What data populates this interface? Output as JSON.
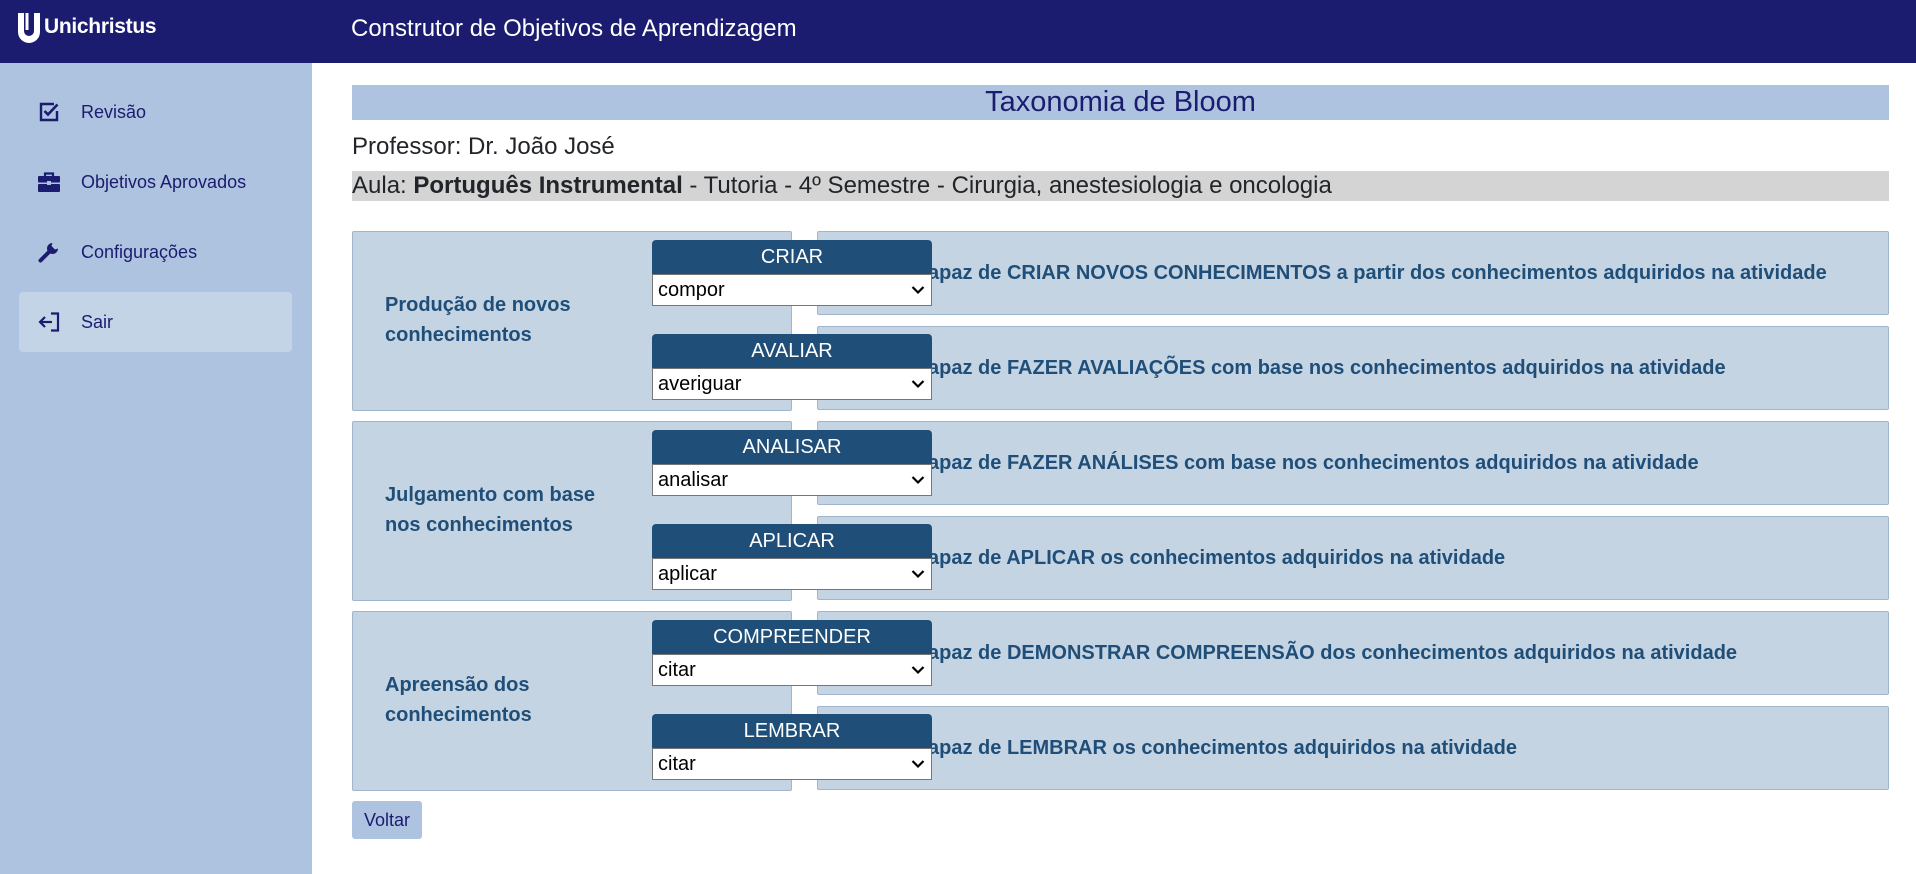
{
  "header": {
    "brand": "Unichristus",
    "title": "Construtor de Objetivos de Aprendizagem"
  },
  "sidebar": {
    "items": [
      {
        "label": "Revisão",
        "icon": "checkbox-edit-icon"
      },
      {
        "label": "Objetivos Aprovados",
        "icon": "briefcase-icon"
      },
      {
        "label": "Configurações",
        "icon": "wrench-icon"
      },
      {
        "label": "Sair",
        "icon": "logout-icon"
      }
    ]
  },
  "main": {
    "heading": "Taxonomia de Bloom",
    "professor": "Professor: Dr. João José",
    "aula": {
      "prefix": "Aula: ",
      "course": "Português Instrumental",
      "details": " - Tutoria - 4º Semestre - Cirurgia, anestesiologia e oncologia"
    },
    "groups": [
      {
        "label": "Produção de novos conhecimentos"
      },
      {
        "label": "Julgamento com base nos conhecimentos"
      },
      {
        "label": "Apreensão dos conhecimentos"
      }
    ],
    "levels": [
      {
        "name": "CRIAR",
        "selected": "compor",
        "pre": "Aluno é capaz de ",
        "action": "CRIAR NOVOS CONHECIMENTOS",
        "post": " a partir dos conhecimentos adquiridos na atividade"
      },
      {
        "name": "AVALIAR",
        "selected": "averiguar",
        "pre": "Aluno é capaz de ",
        "action": "FAZER AVALIAÇÕES",
        "post": " com base nos conhecimentos adquiridos na atividade"
      },
      {
        "name": "ANALISAR",
        "selected": "analisar",
        "pre": "Aluno é capaz de ",
        "action": "FAZER ANÁLISES",
        "post": " com base nos conhecimentos adquiridos na atividade"
      },
      {
        "name": "APLICAR",
        "selected": "aplicar",
        "pre": "Aluno é capaz de ",
        "action": "APLICAR",
        "post": " os conhecimentos adquiridos na atividade"
      },
      {
        "name": "COMPREENDER",
        "selected": "citar",
        "pre": "Aluno é capaz de ",
        "action": "DEMONSTRAR COMPREENSÃO",
        "post": " dos conhecimentos adquiridos na atividade"
      },
      {
        "name": "LEMBRAR",
        "selected": "citar",
        "pre": "Aluno é capaz de ",
        "action": "LEMBRAR",
        "post": " os conhecimentos adquiridos na atividade"
      }
    ],
    "back_label": "Voltar"
  },
  "colors": {
    "topbar": "#1b1b6f",
    "sidebar": "#aec3df",
    "panel": "#c4d4e2",
    "accent": "#1f4e79"
  }
}
